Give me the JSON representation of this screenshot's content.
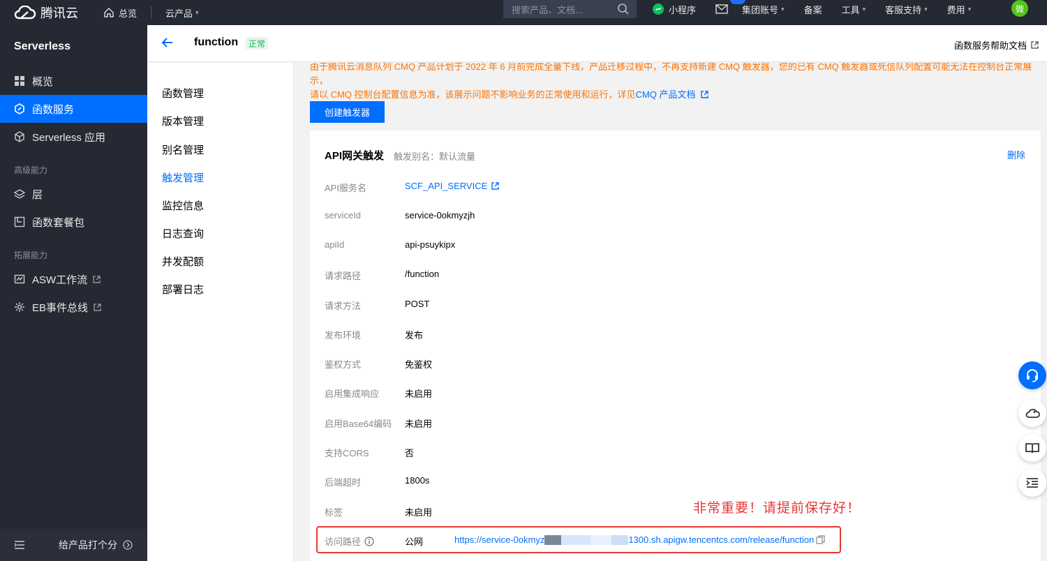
{
  "topbar": {
    "brand": "腾讯云",
    "home": "总览",
    "products": "云产品",
    "search_placeholder": "搜索产品、文档...",
    "mini_program": "小程序",
    "group_account": "集团账号",
    "beian": "备案",
    "tools": "工具",
    "support": "客服支持",
    "billing": "费用",
    "avatar": "微"
  },
  "sidebar": {
    "title": "Serverless",
    "items": [
      {
        "label": "概览",
        "icon": "grid-icon"
      },
      {
        "label": "函数服务",
        "icon": "function-icon"
      },
      {
        "label": "Serverless 应用",
        "icon": "cube-icon"
      }
    ],
    "group_advanced": "高级能力",
    "advanced_items": [
      {
        "label": "层",
        "icon": "layers-icon"
      },
      {
        "label": "函数套餐包",
        "icon": "package-icon"
      }
    ],
    "group_extend": "拓展能力",
    "extend_items": [
      {
        "label": "ASW工作流",
        "icon": "workflow-icon"
      },
      {
        "label": "EB事件总线",
        "icon": "eventbus-icon"
      }
    ],
    "footer_rate": "给产品打个分"
  },
  "header": {
    "function_name": "function",
    "status": "正常",
    "help_doc": "函数服务帮助文档"
  },
  "subnav": {
    "items": [
      "函数管理",
      "版本管理",
      "别名管理",
      "触发管理",
      "监控信息",
      "日志查询",
      "并发配额",
      "部署日志"
    ],
    "active_index": 3
  },
  "notice": {
    "line1": "由于腾讯云消息队列 CMQ 产品计划于 2022 年 6 月前完成全量下线，产品迁移过程中，不再支持新建 CMQ 触发器，您的已有 CMQ 触发器或死信队列配置可能无法在控制台正常展示，",
    "line2": "请以 CMQ 控制台配置信息为准，该展示问题不影响业务的正常使用和运行，详见",
    "link": "CMQ 产品文档"
  },
  "create_button": "创建触发器",
  "trigger": {
    "title": "API网关触发",
    "alias": "触发别名：默认流量",
    "delete": "删除",
    "rows": [
      {
        "label": "API服务名",
        "value": "SCF_API_SERVICE"
      },
      {
        "label": "serviceId",
        "value": "service-0okmyzjh"
      },
      {
        "label": "apiId",
        "value": "api-psuykipx"
      },
      {
        "label": "请求路径",
        "value": "/function"
      },
      {
        "label": "请求方法",
        "value": "POST"
      },
      {
        "label": "发布环境",
        "value": "发布"
      },
      {
        "label": "鉴权方式",
        "value": "免鉴权"
      },
      {
        "label": "启用集成响应",
        "value": "未启用"
      },
      {
        "label": "启用Base64编码",
        "value": "未启用"
      },
      {
        "label": "支持CORS",
        "value": "否"
      },
      {
        "label": "后端超时",
        "value": "1800s"
      },
      {
        "label": "标签",
        "value": "未启用"
      }
    ],
    "access_label": "访问路径",
    "access_network": "公网",
    "url_start": "https://service-0okmyz",
    "url_end": "1300.sh.apigw.tencentcs.com/release/function"
  },
  "annotation": "非常重要！请提前保存好！"
}
